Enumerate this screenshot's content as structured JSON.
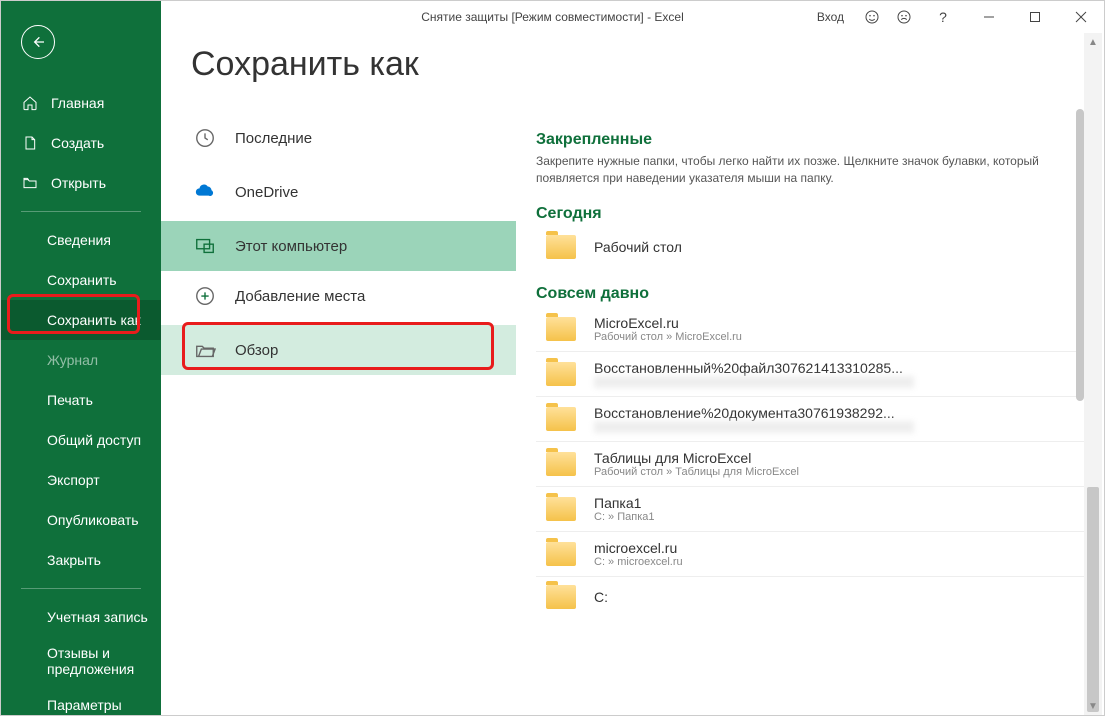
{
  "titlebar": {
    "title": "Снятие защиты  [Режим совместимости]  -  Excel",
    "signin": "Вход"
  },
  "page": {
    "heading": "Сохранить как"
  },
  "sidebar": {
    "home": "Главная",
    "new": "Создать",
    "open": "Открыть",
    "info": "Сведения",
    "save": "Сохранить",
    "saveas": "Сохранить как",
    "history": "Журнал",
    "print": "Печать",
    "share": "Общий доступ",
    "export": "Экспорт",
    "publish": "Опубликовать",
    "close": "Закрыть",
    "account": "Учетная запись",
    "feedback": "Отзывы и предложения",
    "options": "Параметры"
  },
  "locations": {
    "recent": "Последние",
    "onedrive": "OneDrive",
    "thispc": "Этот компьютер",
    "addplace": "Добавление места",
    "browse": "Обзор"
  },
  "pinned": {
    "title": "Закрепленные",
    "desc": "Закрепите нужные папки, чтобы легко найти их позже. Щелкните значок булавки, который появляется при наведении указателя мыши на папку."
  },
  "groups": {
    "today": "Сегодня",
    "older": "Совсем давно"
  },
  "folders": [
    {
      "group": "today",
      "name": "Рабочий стол",
      "path": ""
    },
    {
      "group": "older",
      "name": "MicroExcel.ru",
      "path": "Рабочий стол » MicroExcel.ru"
    },
    {
      "group": "older",
      "name": "Восстановленный%20файл307621413310285...",
      "path": "blur"
    },
    {
      "group": "older",
      "name": "Восстановление%20документа30761938292...",
      "path": "blur"
    },
    {
      "group": "older",
      "name": "Таблицы для MicroExcel",
      "path": "Рабочий стол » Таблицы для MicroExcel"
    },
    {
      "group": "older",
      "name": "Папка1",
      "path": "C: » Папка1"
    },
    {
      "group": "older",
      "name": "microexcel.ru",
      "path": "C: » microexcel.ru"
    },
    {
      "group": "older",
      "name": "C:",
      "path": ""
    }
  ]
}
